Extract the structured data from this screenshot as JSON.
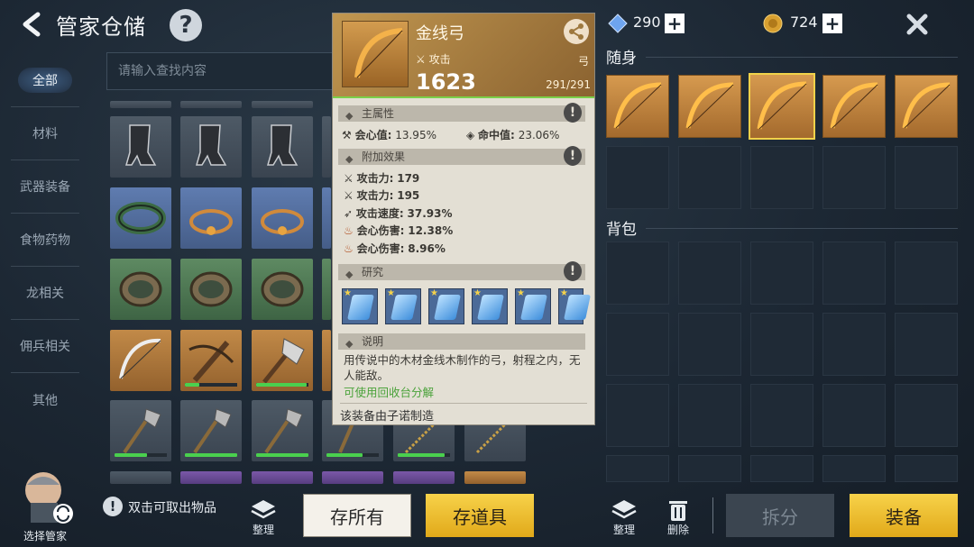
{
  "header": {
    "title": "管家仓储",
    "help": "?"
  },
  "search": {
    "placeholder": "请输入查找内容"
  },
  "sidebar": {
    "items": [
      {
        "label": "全部",
        "active": true
      },
      {
        "label": "材料"
      },
      {
        "label": "武器装备"
      },
      {
        "label": "食物药物"
      },
      {
        "label": "龙相关"
      },
      {
        "label": "佣兵相关"
      },
      {
        "label": "其他"
      }
    ]
  },
  "currency": {
    "gems": "290",
    "coins": "724"
  },
  "tooltip": {
    "name": "金线弓",
    "attack_label": "攻击",
    "type": "弓",
    "power": "1623",
    "durability": "291/291",
    "main_attr_title": "主属性",
    "main_attrs": [
      {
        "label": "会心值:",
        "value": "13.95%"
      },
      {
        "label": "命中值:",
        "value": "23.06%"
      }
    ],
    "extra_title": "附加效果",
    "extra": [
      {
        "label": "攻击力:",
        "value": "179"
      },
      {
        "label": "攻击力:",
        "value": "195"
      },
      {
        "label": "攻击速度:",
        "value": "37.93%"
      },
      {
        "label": "会心伤害:",
        "value": "12.38%"
      },
      {
        "label": "会心伤害:",
        "value": "8.96%"
      }
    ],
    "research_title": "研究",
    "desc_title": "说明",
    "desc": "用传说中的木材金线木制作的弓，射程之内，无人能敌。",
    "recycle": "可使用回收台分解",
    "maker": "该装备由子诺制造"
  },
  "right": {
    "carry_title": "随身",
    "bag_title": "背包"
  },
  "footer": {
    "hint": "双击可取出物品",
    "manager": "选择管家",
    "sort": "整理",
    "store_all": "存所有",
    "store_items": "存道具",
    "sort2": "整理",
    "delete": "删除",
    "split": "拆分",
    "equip": "装备"
  },
  "colors": {
    "gold": "#f1c93a",
    "green": "#4ad04e"
  }
}
